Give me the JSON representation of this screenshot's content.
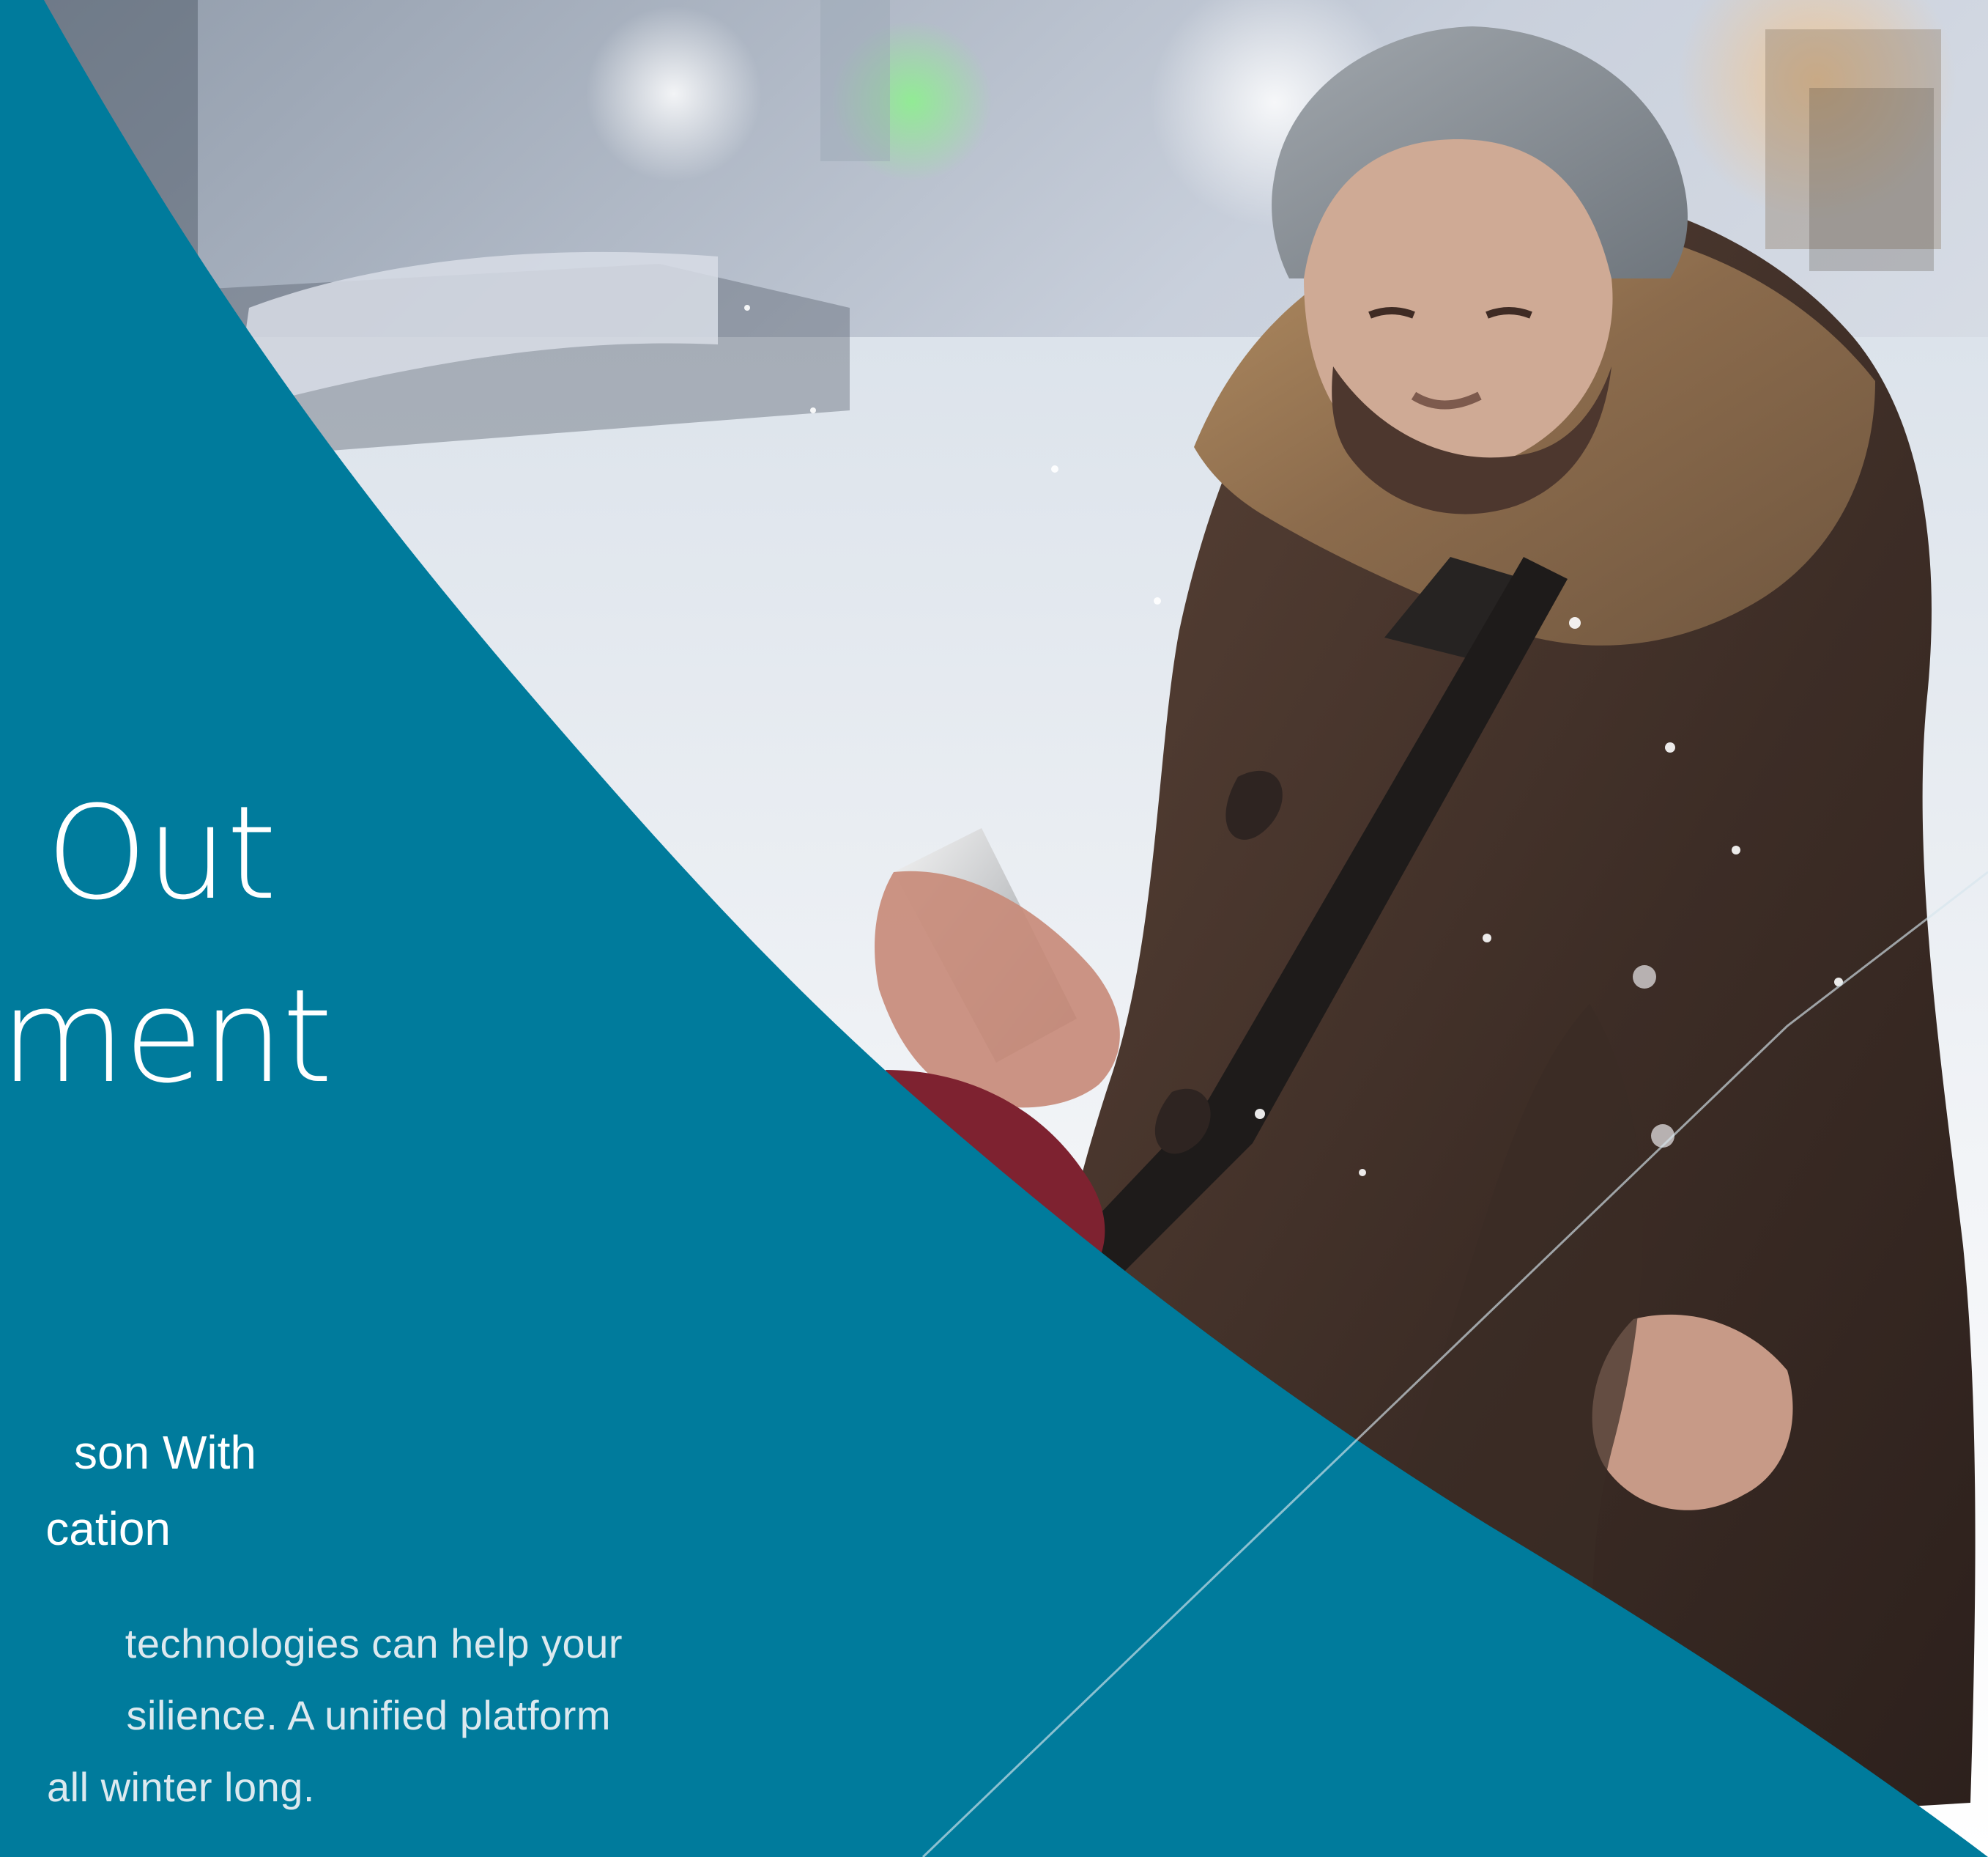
{
  "colors": {
    "teal_panel": "#007b9c",
    "white_text": "#ffffff",
    "soft_white_text": "#dce9ef",
    "snow": "#eef2f5",
    "coat": "#4a362d",
    "hat": "#8d9297"
  },
  "hero": {
    "headline_lines": [
      "Out",
      "ment"
    ],
    "subhead_lines": [
      "son With",
      "cation"
    ],
    "body_lines": [
      "technologies can help your",
      "silience. A unified platform",
      "all winter long."
    ]
  }
}
